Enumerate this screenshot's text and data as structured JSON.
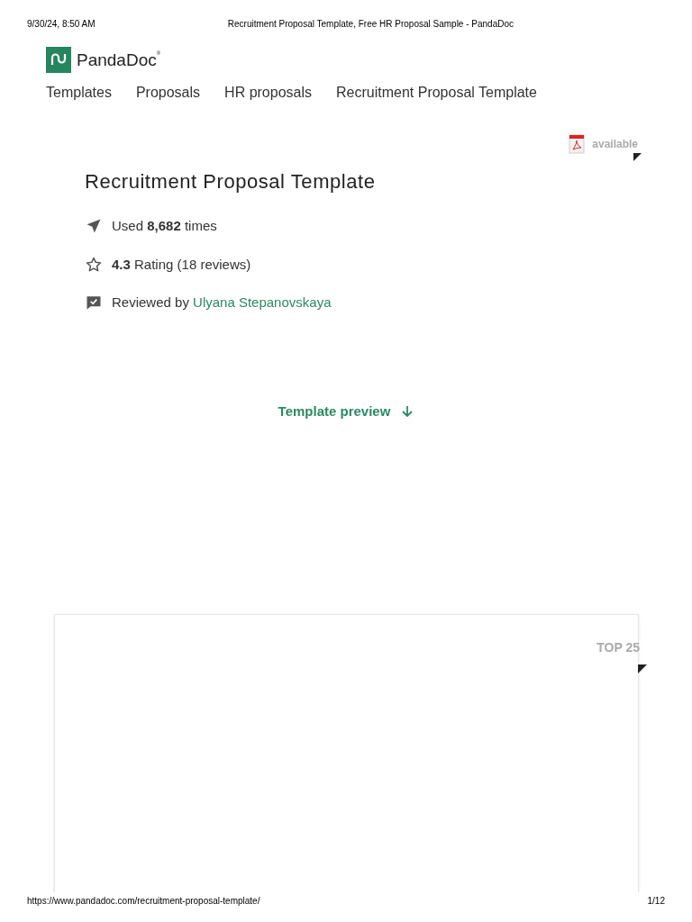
{
  "print_header": {
    "date": "9/30/24, 8:50 AM",
    "title": "Recruitment Proposal Template, Free HR Proposal Sample - PandaDoc"
  },
  "logo": {
    "text": "PandaDoc",
    "mark": "®"
  },
  "breadcrumbs": [
    "Templates",
    "Proposals",
    "HR proposals",
    "Recruitment Proposal Template"
  ],
  "pdf_badge": {
    "text": "available"
  },
  "title": "Recruitment Proposal Template",
  "stats": [
    {
      "kind": "used",
      "text": "Used **8,682** times"
    },
    {
      "kind": "rating",
      "text": "**4.3** Rating (18 reviews)"
    },
    {
      "kind": "reviewed",
      "text": "Reviewed by",
      "link": "Ulyana Stepanovskaya"
    }
  ],
  "preview_link": "Template preview",
  "card": {
    "badge": "TOP 25"
  },
  "print_footer": {
    "url": "https://www.pandadoc.com/recruitment-proposal-template/",
    "page": "1/12"
  }
}
